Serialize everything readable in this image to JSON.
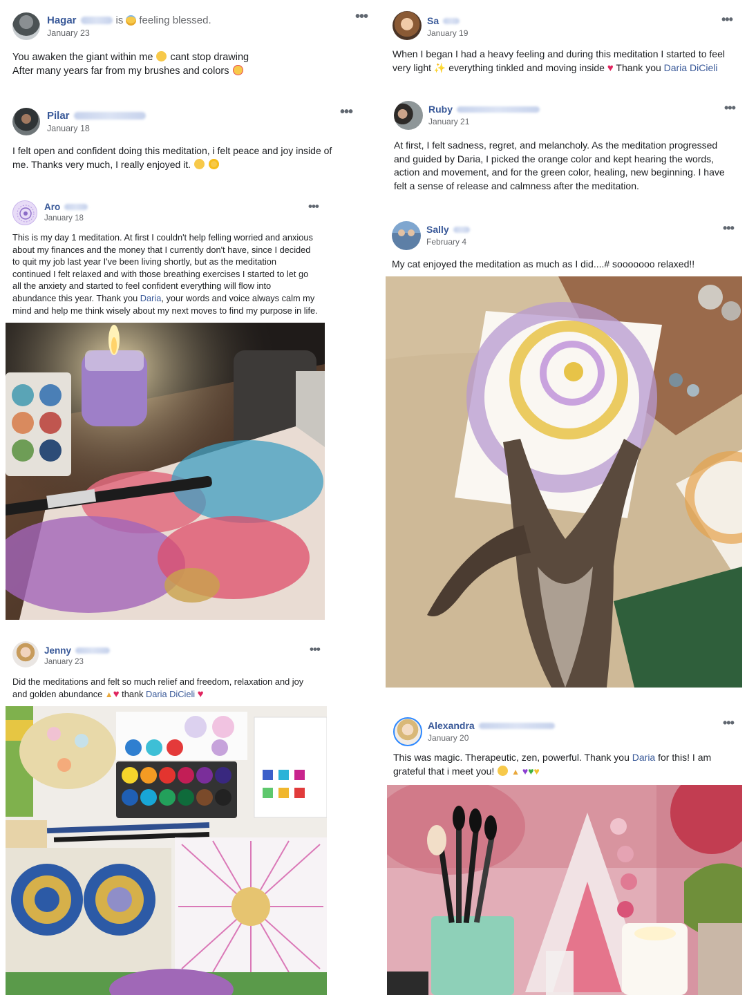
{
  "posts": [
    {
      "author": "Hagar",
      "feeling": "is",
      "feeling_text": "feeling blessed.",
      "date": "January 23",
      "lines": [
        "You awaken the giant within me",
        "cant stop drawing",
        "After many years far from my brushes and colors"
      ]
    },
    {
      "author": "Pilar",
      "date": "January 18",
      "lines": [
        "I felt open and confident doing this meditation, i felt peace and joy inside of",
        "me. Thanks very much, I really enjoyed it."
      ]
    },
    {
      "author": "Aro",
      "date": "January 18",
      "lines": [
        "This is my day 1 meditation. At first I couldn't help felling worried and anxious",
        "about my finances and the money that I currently don't have, since I decided",
        "to quit my job last year I've been living shortly, but as the meditation",
        "continued I felt relaxed and with those breathing exercises I started to let go",
        "all the anxiety and started to feel confident everything will flow into",
        "abundance this year. Thank you",
        "Daria",
        ", your words and voice always calm my",
        "mind and help me think wisely about my next moves to find my purpose in life."
      ]
    },
    {
      "author": "Jenny",
      "date": "January 23",
      "lines": [
        "Did the meditations and felt so much relief and freedom, relaxation and joy",
        "and golden abundance",
        "thank",
        "Daria DiCieli"
      ]
    },
    {
      "author": "Sa",
      "date": "January 19",
      "lines": [
        "When I began I had a heavy feeling and during this meditation I started to feel",
        "very light",
        "everything tinkled and moving inside",
        "Thank you",
        "Daria DiCieli"
      ]
    },
    {
      "author": "Ruby",
      "date": "January 21",
      "lines": [
        "At first, I felt sadness, regret, and melancholy. As the meditation progressed",
        "and guided by Daria, I picked the orange color and kept hearing the words,",
        "action and movement, and for the green color, healing, new beginning. I have",
        "felt a sense of release and calmness after the meditation."
      ]
    },
    {
      "author": "Sally",
      "date": "February 4",
      "lines": [
        "My cat enjoyed the meditation as much as I did....# sooooooo relaxed!!"
      ]
    },
    {
      "author": "Alexandra",
      "date": "January 20",
      "lines": [
        "This was magic. Therapeutic, zen, powerful. Thank you",
        "Daria",
        "for this! I am",
        "grateful that i meet you!"
      ]
    }
  ],
  "more_label": "•••",
  "colors": {
    "link": "#385898",
    "meta": "#65676b",
    "text": "#1c1e21"
  }
}
